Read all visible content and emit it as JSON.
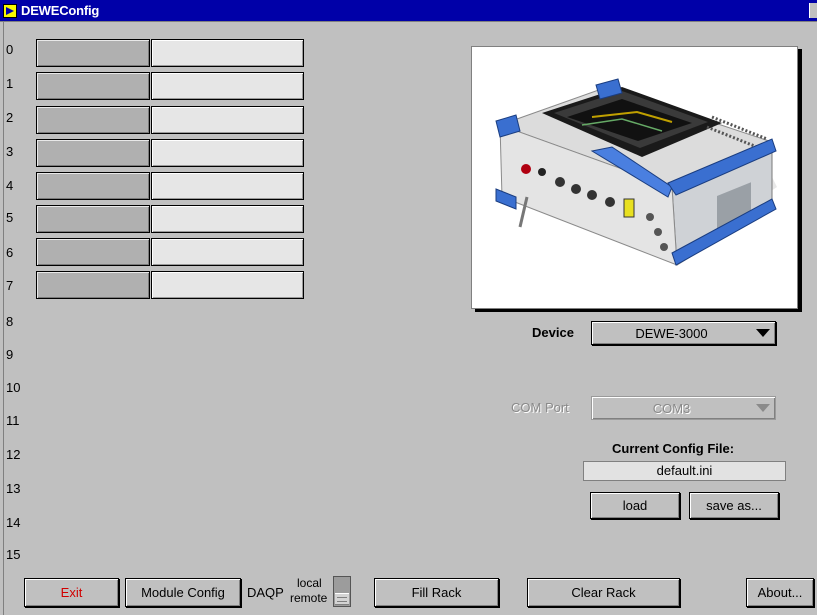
{
  "window": {
    "title": "DEWEConfig"
  },
  "rack": {
    "slots": [
      "0",
      "1",
      "2",
      "3",
      "4",
      "5",
      "6",
      "7"
    ],
    "extra_rows": [
      "8",
      "9",
      "10",
      "11",
      "12",
      "13",
      "14",
      "15"
    ]
  },
  "device": {
    "label": "Device",
    "value": "DEWE-3000"
  },
  "com_port": {
    "label": "COM Port",
    "value": "COM3"
  },
  "config": {
    "label": "Current Config File:",
    "value": "default.ini",
    "load_label": "load",
    "save_label": "save as..."
  },
  "bottom": {
    "exit_label": "Exit",
    "module_config_label": "Module Config",
    "daqp_label": "DAQP",
    "local_label": "local",
    "remote_label": "remote",
    "fill_rack_label": "Fill Rack",
    "clear_rack_label": "Clear Rack",
    "about_label": "About..."
  },
  "colors": {
    "titlebar": "#0000a8",
    "exit_text": "#d00000",
    "background": "#c0c0c0"
  }
}
